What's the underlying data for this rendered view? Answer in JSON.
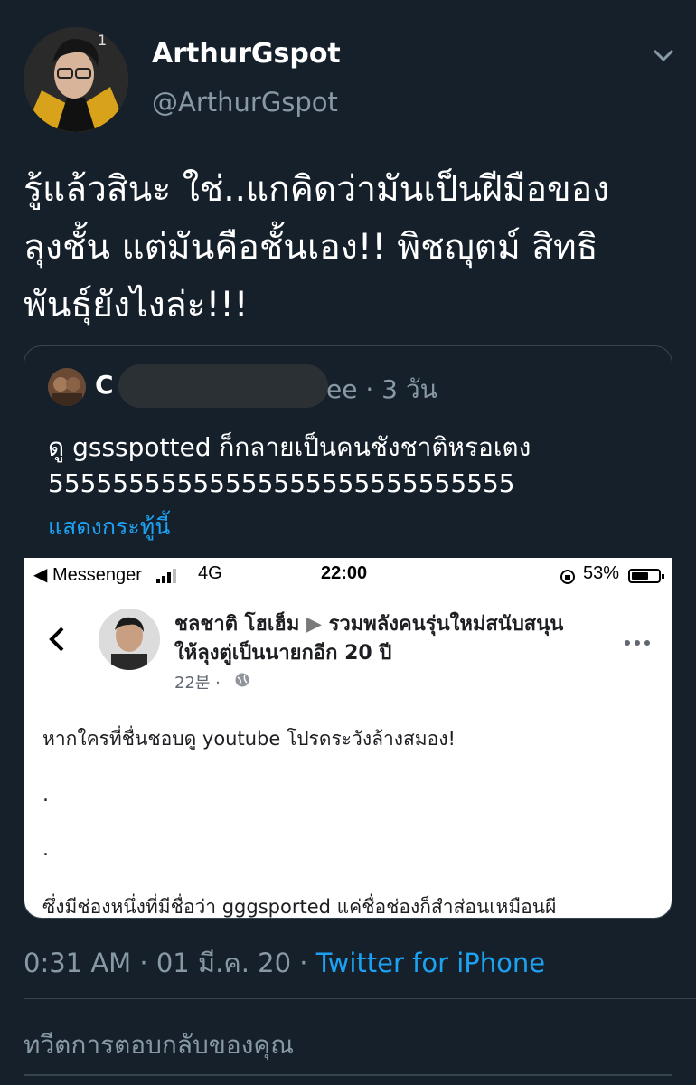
{
  "tweet": {
    "display_name": "ArthurGspot",
    "handle": "@ArthurGspot",
    "text_lines": [
      "รู้แล้วสินะ ใช่..แกคิดว่ามันเป็นฝีมือของ",
      "ลุงชั้น แต่มันคือชั้นเอง!! พิชญุตม์ สิทธิ",
      "พันธุ์ยังไงล่ะ!!!"
    ],
    "time": "0:31 AM",
    "date": "01 มี.ค. 20",
    "sep": "·",
    "source": "Twitter for iPhone"
  },
  "quote": {
    "name_start": "C",
    "name_end": "ee",
    "time": "· 3 วัน",
    "text_lines": [
      "ดู gssspotted ก็กลายเป็นคนชังชาติหรอเตง",
      "55555555555555555555555555555"
    ],
    "show_thread": "แสดงกระทู้นี้"
  },
  "screenshot": {
    "status": {
      "back_app": "◀ Messenger",
      "network": "4G",
      "time": "22:00",
      "battery": "53%"
    },
    "post": {
      "author": "ชลชาติ โฮเฮ็ม",
      "arrow": "▶",
      "group_line1": "รวมพลังคนรุ่นใหม่สนับสนุน",
      "group_line2": "ให้ลุงตู่เป็นนายกอีก 20 ปี",
      "time": "22분 ·",
      "body_line1": "หากใครที่ชื่นชอบดู youtube โปรดระวังล้างสมอง!",
      "dot": ".",
      "body_last": "ซึ่งมีช่องหนึ่งที่มีชื่อว่า gggsported แค่ชื่อช่องก็สำส่อนเหมือนผี"
    }
  },
  "reply": {
    "placeholder": "ทวีตการตอบกลับของคุณ"
  },
  "colors": {
    "background": "#15202b",
    "muted": "#8899a6",
    "link": "#1da1f2",
    "border": "#38444d"
  }
}
